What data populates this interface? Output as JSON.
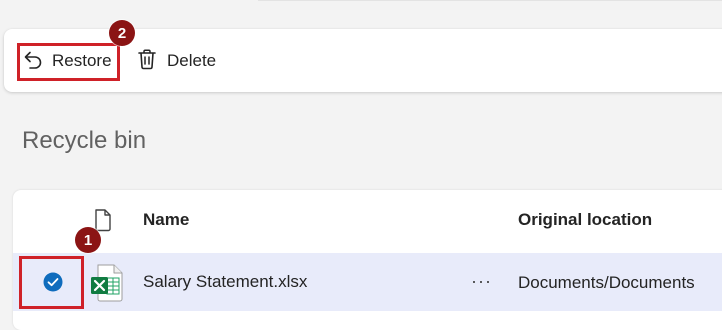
{
  "toolbar": {
    "restore_label": "Restore",
    "delete_label": "Delete",
    "restore_icon": "undo-arrow-icon",
    "delete_icon": "trash-icon"
  },
  "page": {
    "title": "Recycle bin"
  },
  "annotations": {
    "badge_1": "1",
    "badge_2": "2",
    "highlight_color": "#cf2128",
    "badge_color": "#8b1414"
  },
  "table": {
    "columns": {
      "type_icon": "file-icon",
      "name": "Name",
      "original_location": "Original location"
    },
    "rows": [
      {
        "selected": true,
        "file_icon": "excel-file-icon",
        "name": "Salary Statement.xlsx",
        "more": "···",
        "original_location": "Documents/Documents"
      }
    ]
  },
  "colors": {
    "accent": "#0f6cbd",
    "selected_row": "#e8ebfa",
    "excel_green": "#107c41"
  }
}
